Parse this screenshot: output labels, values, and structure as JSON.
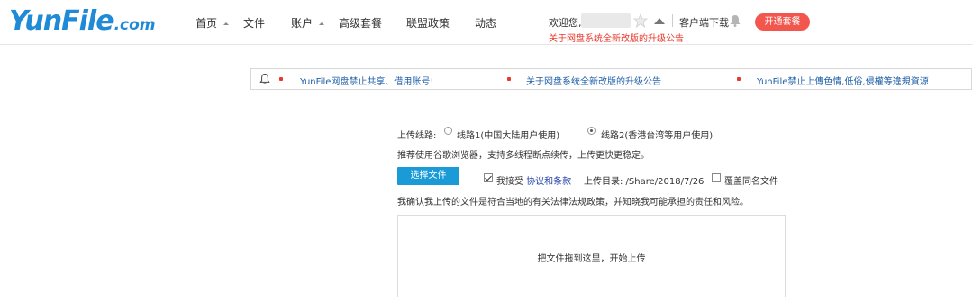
{
  "header": {
    "logo_brand": "YunFile",
    "logo_tld": ".com",
    "nav": [
      {
        "label": "首页",
        "has_caret": true
      },
      {
        "label": "文件",
        "has_caret": false
      },
      {
        "label": "账户",
        "has_caret": true
      },
      {
        "label": "高级套餐",
        "has_caret": false
      },
      {
        "label": "联盟政策",
        "has_caret": false
      },
      {
        "label": "动态",
        "has_caret": false
      }
    ],
    "welcome": "欢迎您,",
    "announcement_link": "关于网盘系统全新改版的升级公告",
    "client_download": "客户端下载",
    "open_package_button": "开通套餐"
  },
  "notice_bar": {
    "items": [
      "YunFile网盘禁止共享、借用账号!",
      "关于网盘系统全新改版的升级公告",
      "YunFile禁止上傳色情,低俗,侵權等違規資源"
    ]
  },
  "upload": {
    "route_label": "上传线路:",
    "route_options": [
      {
        "label": "线路1(中国大陆用户使用)",
        "checked": false
      },
      {
        "label": "线路2(香港台湾等用户使用)",
        "checked": true
      }
    ],
    "browser_tip": "推荐使用谷歌浏览器，支持多线程断点续传，上传更快更稳定。",
    "choose_file_button": "选择文件",
    "agree_prefix": "我接受",
    "agree_link": "协议和条款",
    "agree_checked": true,
    "dir_label": "上传目录: /Share/2018/7/26",
    "overwrite_label": "覆盖同名文件",
    "overwrite_checked": false,
    "confirm_text": "我确认我上传的文件是符合当地的有关法律法规政策，并知晓我可能承担的责任和风险。",
    "dropzone_text": "把文件拖到这里，开始上传"
  }
}
